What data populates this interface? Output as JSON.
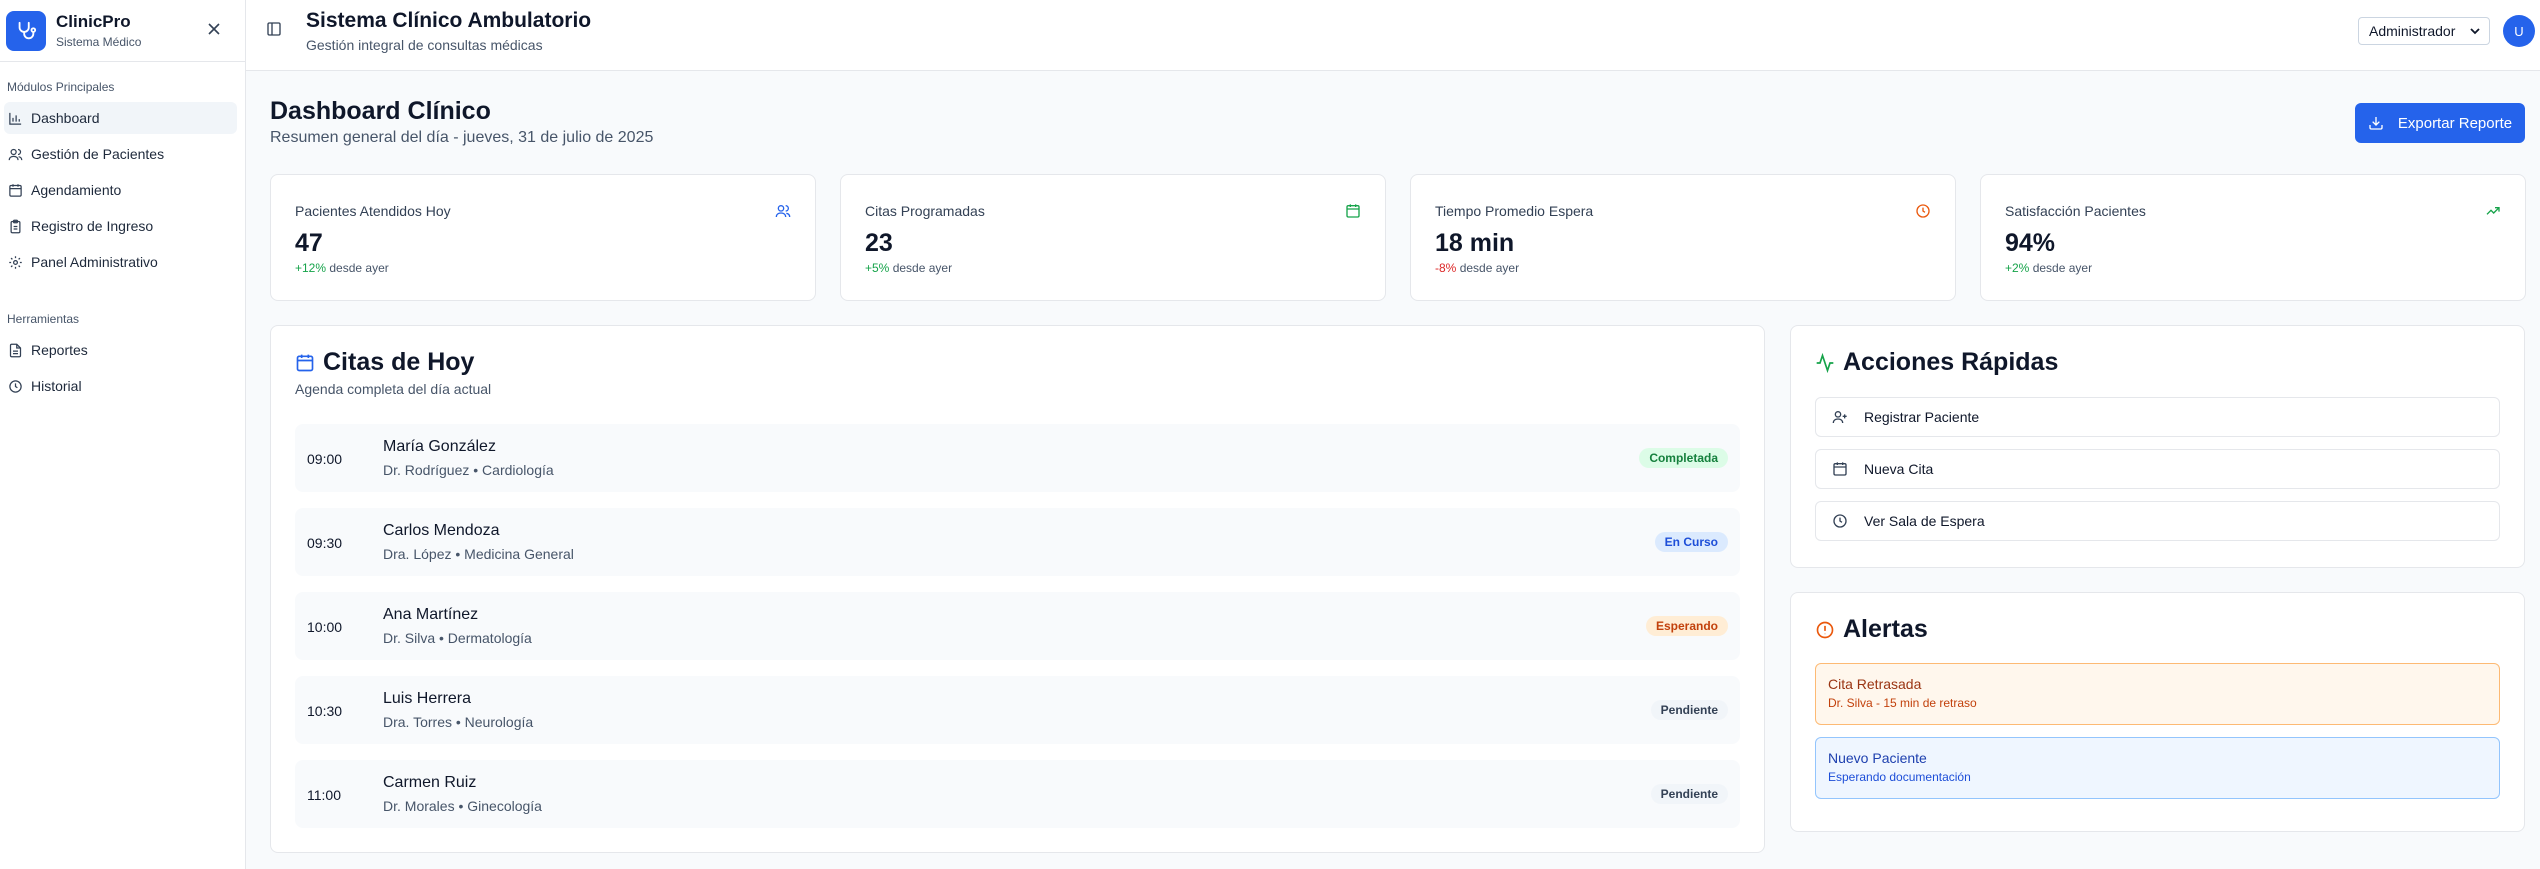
{
  "sidebar": {
    "brand_name": "ClinicPro",
    "brand_sub": "Sistema Médico",
    "section_main": "Módulos Principales",
    "section_tools": "Herramientas",
    "main_items": [
      {
        "label": "Dashboard",
        "icon": "bar-chart-icon"
      },
      {
        "label": "Gestión de Pacientes",
        "icon": "users-icon"
      },
      {
        "label": "Agendamiento",
        "icon": "calendar-icon"
      },
      {
        "label": "Registro de Ingreso",
        "icon": "clipboard-icon"
      },
      {
        "label": "Panel Administrativo",
        "icon": "gear-icon"
      }
    ],
    "tool_items": [
      {
        "label": "Reportes",
        "icon": "file-icon"
      },
      {
        "label": "Historial",
        "icon": "clock-icon"
      }
    ]
  },
  "header": {
    "title": "Sistema Clínico Ambulatorio",
    "subtitle": "Gestión integral de consultas médicas",
    "role": "Administrador",
    "avatar": "U"
  },
  "page": {
    "title": "Dashboard Clínico",
    "subtitle": "Resumen general del día - jueves, 31 de julio de 2025",
    "export_label": "Exportar Reporte"
  },
  "stats": [
    {
      "label": "Pacientes Atendidos Hoy",
      "value": "47",
      "delta": "+12%",
      "delta_text": "desde ayer",
      "trend": "up",
      "icon": "users-icon",
      "icon_color": "#2563eb"
    },
    {
      "label": "Citas Programadas",
      "value": "23",
      "delta": "+5%",
      "delta_text": "desde ayer",
      "trend": "up",
      "icon": "calendar-icon",
      "icon_color": "#16a34a"
    },
    {
      "label": "Tiempo Promedio Espera",
      "value": "18 min",
      "delta": "-8%",
      "delta_text": "desde ayer",
      "trend": "down",
      "icon": "clock-icon",
      "icon_color": "#ea580c"
    },
    {
      "label": "Satisfacción Pacientes",
      "value": "94%",
      "delta": "+2%",
      "delta_text": "desde ayer",
      "trend": "up",
      "icon": "trending-up-icon",
      "icon_color": "#16a34a"
    }
  ],
  "appointments": {
    "title": "Citas de Hoy",
    "subtitle": "Agenda completa del día actual",
    "items": [
      {
        "time": "09:00",
        "name": "María González",
        "detail": "Dr. Rodríguez • Cardiología",
        "status": "Completada"
      },
      {
        "time": "09:30",
        "name": "Carlos Mendoza",
        "detail": "Dra. López • Medicina General",
        "status": "En Curso"
      },
      {
        "time": "10:00",
        "name": "Ana Martínez",
        "detail": "Dr. Silva • Dermatología",
        "status": "Esperando"
      },
      {
        "time": "10:30",
        "name": "Luis Herrera",
        "detail": "Dra. Torres • Neurología",
        "status": "Pendiente"
      },
      {
        "time": "11:00",
        "name": "Carmen Ruiz",
        "detail": "Dr. Morales • Ginecología",
        "status": "Pendiente"
      }
    ]
  },
  "quick_actions": {
    "title": "Acciones Rápidas",
    "items": [
      {
        "label": "Registrar Paciente",
        "icon": "user-plus-icon"
      },
      {
        "label": "Nueva Cita",
        "icon": "calendar-icon"
      },
      {
        "label": "Ver Sala de Espera",
        "icon": "clock-icon"
      }
    ]
  },
  "alerts": {
    "title": "Alertas",
    "items": [
      {
        "title": "Cita Retrasada",
        "text": "Dr. Silva - 15 min de retraso",
        "kind": "warning"
      },
      {
        "title": "Nuevo Paciente",
        "text": "Esperando documentación",
        "kind": "info"
      }
    ]
  },
  "colors": {
    "primary": "#2563eb",
    "success": "#16a34a",
    "warning": "#ea580c",
    "danger": "#dc2626"
  }
}
